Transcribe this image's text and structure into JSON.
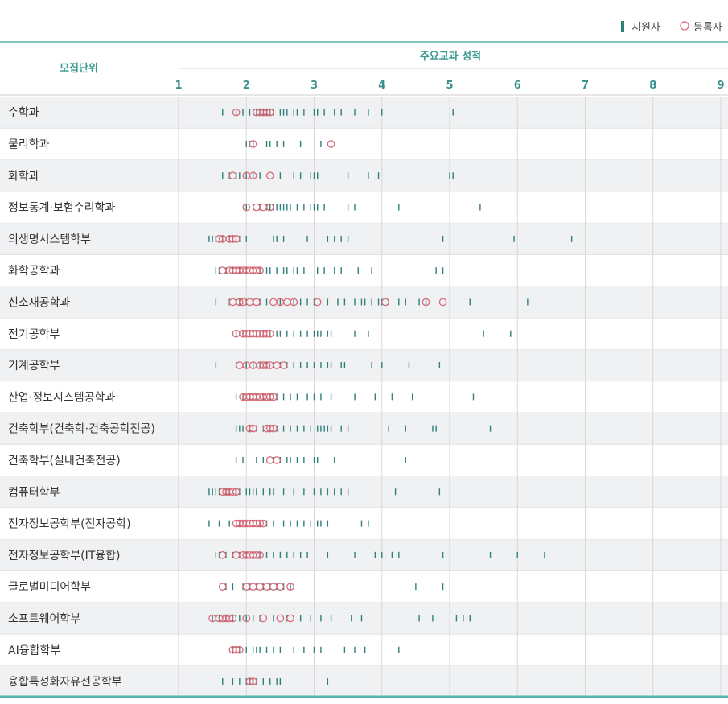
{
  "legend": {
    "applicant": "지원자",
    "registrant": "등록자"
  },
  "header": {
    "unit_label": "모집단위",
    "axis_title": "주요교과 성적"
  },
  "colors": {
    "applicant": "#2f7f7b",
    "registrant": "#d96b78",
    "rule": "#5ab3ad",
    "band": "#f0f1f3",
    "grid": "#d8d8d8",
    "tick_text": "#3a8f8a",
    "header_text": "#3a9a94"
  },
  "chart_data": {
    "type": "scatter",
    "xlabel": "주요교과 성적",
    "xlim": [
      1,
      9
    ],
    "ticks": [
      1,
      2,
      3,
      4,
      5,
      6,
      7,
      8,
      9
    ],
    "categories": [
      "수학과",
      "물리학과",
      "화학과",
      "정보통계·보험수리학과",
      "의생명시스템학부",
      "화학공학과",
      "신소재공학과",
      "전기공학부",
      "기계공학부",
      "산업·정보시스템공학과",
      "건축학부(건축학·건축공학전공)",
      "건축학부(실내건축전공)",
      "컴퓨터학부",
      "전자정보공학부(전자공학)",
      "전자정보공학부(IT융합)",
      "글로벌미디어학부",
      "소프트웨어학부",
      "AI융합학부",
      "융합특성화자유전공학부"
    ],
    "series": [
      {
        "name": "지원자",
        "marker": "tick",
        "points": [
          [
            1.65,
            1.85,
            1.95,
            2.05,
            2.1,
            2.15,
            2.2,
            2.25,
            2.3,
            2.35,
            2.4,
            2.5,
            2.55,
            2.6,
            2.7,
            2.75,
            2.85,
            3.0,
            3.05,
            3.15,
            3.3,
            3.4,
            3.6,
            3.8,
            4.0,
            5.05
          ],
          [
            2.0,
            2.05,
            2.1,
            2.3,
            2.35,
            2.45,
            2.55,
            2.8,
            3.1
          ],
          [
            1.65,
            1.75,
            1.85,
            1.9,
            2.0,
            2.1,
            2.2,
            2.5,
            2.7,
            2.8,
            2.95,
            3.0,
            3.05,
            3.5,
            3.8,
            3.95,
            5.0,
            5.05
          ],
          [
            2.0,
            2.1,
            2.2,
            2.3,
            2.35,
            2.4,
            2.45,
            2.5,
            2.55,
            2.6,
            2.65,
            2.75,
            2.85,
            2.95,
            3.0,
            3.05,
            3.15,
            3.5,
            3.6,
            4.25,
            5.45
          ],
          [
            1.45,
            1.5,
            1.55,
            1.65,
            1.75,
            1.8,
            1.9,
            2.0,
            2.4,
            2.45,
            2.55,
            2.9,
            3.2,
            3.3,
            3.4,
            3.5,
            4.9,
            5.95,
            6.8
          ],
          [
            1.55,
            1.6,
            1.7,
            1.8,
            1.9,
            2.0,
            2.1,
            2.2,
            2.3,
            2.35,
            2.45,
            2.55,
            2.6,
            2.7,
            2.75,
            2.85,
            3.05,
            3.15,
            3.3,
            3.4,
            3.65,
            3.85,
            4.8,
            4.9
          ],
          [
            1.55,
            1.75,
            1.9,
            2.0,
            2.1,
            2.2,
            2.3,
            2.5,
            2.7,
            2.8,
            2.9,
            3.0,
            3.2,
            3.35,
            3.45,
            3.6,
            3.7,
            3.75,
            3.85,
            3.95,
            4.0,
            4.1,
            4.25,
            4.35,
            4.55,
            4.65,
            5.3,
            6.15
          ],
          [
            1.85,
            1.95,
            2.05,
            2.15,
            2.25,
            2.35,
            2.45,
            2.5,
            2.6,
            2.7,
            2.8,
            2.9,
            3.0,
            3.05,
            3.1,
            3.2,
            3.25,
            3.6,
            3.8,
            5.5,
            5.9
          ],
          [
            1.55,
            1.85,
            2.0,
            2.1,
            2.2,
            2.3,
            2.4,
            2.5,
            2.6,
            2.7,
            2.8,
            2.9,
            3.0,
            3.1,
            3.2,
            3.25,
            3.4,
            3.45,
            3.85,
            4.0,
            4.4,
            4.85
          ],
          [
            1.85,
            1.95,
            2.05,
            2.15,
            2.25,
            2.35,
            2.45,
            2.55,
            2.65,
            2.75,
            2.9,
            3.0,
            3.1,
            3.25,
            3.6,
            3.9,
            4.15,
            4.45,
            5.35
          ],
          [
            1.85,
            1.9,
            1.95,
            2.05,
            2.15,
            2.25,
            2.35,
            2.45,
            2.55,
            2.65,
            2.75,
            2.85,
            2.95,
            3.05,
            3.1,
            3.15,
            3.2,
            3.25,
            3.4,
            3.5,
            4.1,
            4.35,
            4.75,
            4.8,
            5.6
          ],
          [
            1.85,
            1.95,
            2.15,
            2.25,
            2.4,
            2.5,
            2.6,
            2.65,
            2.75,
            2.85,
            3.0,
            3.05,
            3.3,
            4.35
          ],
          [
            1.45,
            1.5,
            1.55,
            1.6,
            1.7,
            1.75,
            1.85,
            1.9,
            2.0,
            2.05,
            2.1,
            2.15,
            2.25,
            2.35,
            2.4,
            2.55,
            2.7,
            2.85,
            3.0,
            3.1,
            3.2,
            3.3,
            3.4,
            3.5,
            4.2,
            4.85
          ],
          [
            1.45,
            1.6,
            1.75,
            1.85,
            1.9,
            2.0,
            2.1,
            2.2,
            2.3,
            2.4,
            2.55,
            2.65,
            2.75,
            2.85,
            2.95,
            3.05,
            3.1,
            3.2,
            3.7,
            3.8
          ],
          [
            1.55,
            1.6,
            1.7,
            1.8,
            1.9,
            2.0,
            2.1,
            2.2,
            2.3,
            2.4,
            2.5,
            2.6,
            2.7,
            2.8,
            2.9,
            3.2,
            3.6,
            3.9,
            4.0,
            4.15,
            4.25,
            4.9,
            5.6,
            6.0,
            6.4
          ],
          [
            1.7,
            1.8,
            1.95,
            2.05,
            2.15,
            2.25,
            2.35,
            2.45,
            2.55,
            2.65,
            4.9,
            4.5
          ],
          [
            1.5,
            1.6,
            1.7,
            1.8,
            1.9,
            2.0,
            2.1,
            2.2,
            2.4,
            2.6,
            2.8,
            2.95,
            3.1,
            3.25,
            3.55,
            3.7,
            4.55,
            4.75,
            5.1,
            5.2,
            5.3
          ],
          [
            1.8,
            1.85,
            1.9,
            2.0,
            2.1,
            2.15,
            2.2,
            2.3,
            2.4,
            2.5,
            2.7,
            2.85,
            3.0,
            3.1,
            3.45,
            3.6,
            3.75,
            4.25
          ],
          [
            1.65,
            1.8,
            1.9,
            2.0,
            2.05,
            2.1,
            2.15,
            2.25,
            2.35,
            2.45,
            2.5,
            3.2
          ]
        ]
      },
      {
        "name": "등록자",
        "marker": "circle",
        "points": [
          [
            1.85,
            2.15,
            2.2,
            2.25,
            2.3,
            2.35
          ],
          [
            2.1,
            3.25
          ],
          [
            1.8,
            2.0,
            2.1,
            2.35
          ],
          [
            2.0,
            2.15,
            2.25,
            2.35
          ],
          [
            1.6,
            1.65,
            1.75,
            1.8,
            1.85
          ],
          [
            1.65,
            1.75,
            1.8,
            1.85,
            1.9,
            1.95,
            2.0,
            2.05,
            2.1,
            2.15,
            2.2
          ],
          [
            1.8,
            1.9,
            1.95,
            2.05,
            2.15,
            2.4,
            2.5,
            2.6,
            2.7,
            3.05,
            4.05,
            4.9,
            4.65
          ],
          [
            1.85,
            1.95,
            2.0,
            2.05,
            2.1,
            2.15,
            2.2,
            2.25,
            2.3,
            2.35
          ],
          [
            1.9,
            2.0,
            2.1,
            2.2,
            2.25,
            2.3,
            2.35,
            2.45,
            2.55
          ],
          [
            1.95,
            2.0,
            2.05,
            2.1,
            2.15,
            2.2,
            2.25,
            2.3,
            2.35,
            2.4
          ],
          [
            2.05,
            2.1,
            2.3,
            2.35,
            2.4
          ],
          [
            2.35,
            2.45
          ],
          [
            1.65,
            1.7,
            1.75,
            1.8,
            1.85
          ],
          [
            1.85,
            1.9,
            1.95,
            2.0,
            2.05,
            2.1,
            2.15,
            2.2,
            2.25
          ],
          [
            1.65,
            1.85,
            1.95,
            2.0,
            2.05,
            2.1,
            2.15,
            2.2
          ],
          [
            1.65,
            2.0,
            2.1,
            2.2,
            2.3,
            2.4,
            2.5,
            2.65
          ],
          [
            1.5,
            1.6,
            1.65,
            1.7,
            1.75,
            1.8,
            2.0,
            2.25,
            2.5,
            2.65
          ],
          [
            1.8,
            1.85,
            1.9
          ],
          [
            2.05,
            2.1
          ]
        ]
      }
    ]
  }
}
